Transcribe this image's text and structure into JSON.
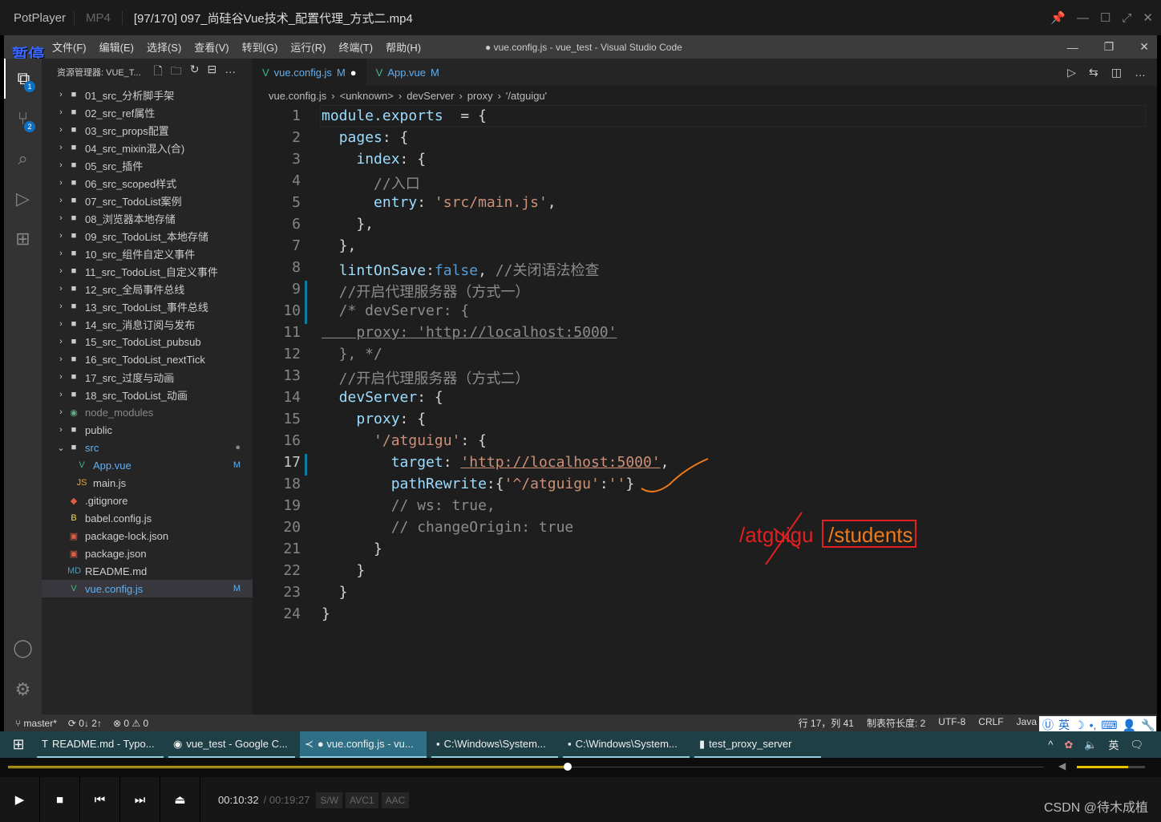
{
  "player": {
    "brand": "PotPlayer",
    "format": "MP4",
    "file": "[97/170] 097_尚硅谷Vue技术_配置代理_方式二.mp4",
    "pause_label": "暂停",
    "elapsed": "00:10:32",
    "total": "/ 00:19:27",
    "tags": [
      "S/W",
      "AVC1",
      "AAC"
    ],
    "progress": 0.54,
    "volume": 0.75,
    "watermark": "CSDN @待木成植"
  },
  "menu": [
    "文件(F)",
    "编辑(E)",
    "选择(S)",
    "查看(V)",
    "转到(G)",
    "运行(R)",
    "终端(T)",
    "帮助(H)"
  ],
  "window_title": "● vue.config.js - vue_test - Visual Studio Code",
  "activity": {
    "explorer_badge": "1",
    "scm_badge": "2"
  },
  "explorer": {
    "title": "资源管理器: VUE_T...",
    "items": [
      {
        "label": "01_src_分析脚手架",
        "type": "folder"
      },
      {
        "label": "02_src_ref属性",
        "type": "folder"
      },
      {
        "label": "03_src_props配置",
        "type": "folder"
      },
      {
        "label": "04_src_mixin混入(合)",
        "type": "folder"
      },
      {
        "label": "05_src_插件",
        "type": "folder"
      },
      {
        "label": "06_src_scoped样式",
        "type": "folder"
      },
      {
        "label": "07_src_TodoList案例",
        "type": "folder"
      },
      {
        "label": "08_浏览器本地存储",
        "type": "folder"
      },
      {
        "label": "09_src_TodoList_本地存储",
        "type": "folder"
      },
      {
        "label": "10_src_组件自定义事件",
        "type": "folder"
      },
      {
        "label": "11_src_TodoList_自定义事件",
        "type": "folder"
      },
      {
        "label": "12_src_全局事件总线",
        "type": "folder"
      },
      {
        "label": "13_src_TodoList_事件总线",
        "type": "folder"
      },
      {
        "label": "14_src_消息订阅与发布",
        "type": "folder"
      },
      {
        "label": "15_src_TodoList_pubsub",
        "type": "folder"
      },
      {
        "label": "16_src_TodoList_nextTick",
        "type": "folder"
      },
      {
        "label": "17_src_过度与动画",
        "type": "folder"
      },
      {
        "label": "18_src_TodoList_动画",
        "type": "folder"
      },
      {
        "label": "node_modules",
        "type": "folder-dim"
      },
      {
        "label": "public",
        "type": "folder"
      },
      {
        "label": "src",
        "type": "folder-open",
        "status": "●"
      },
      {
        "label": "App.vue",
        "type": "vue",
        "indent": 2,
        "status": "M"
      },
      {
        "label": "main.js",
        "type": "js",
        "indent": 2
      },
      {
        "label": ".gitignore",
        "type": "git"
      },
      {
        "label": "babel.config.js",
        "type": "babel"
      },
      {
        "label": "package-lock.json",
        "type": "json"
      },
      {
        "label": "package.json",
        "type": "json"
      },
      {
        "label": "README.md",
        "type": "md"
      },
      {
        "label": "vue.config.js",
        "type": "vue",
        "status": "M",
        "selected": true
      }
    ]
  },
  "tabs": [
    {
      "label": "vue.config.js",
      "status": "M",
      "dirty": "●",
      "active": true
    },
    {
      "label": "App.vue",
      "status": "M"
    }
  ],
  "breadcrumb": [
    "vue.config.js",
    "<unknown>",
    "devServer",
    "proxy",
    "'/atguigu'"
  ],
  "code": {
    "current_line": 17,
    "lines": [
      [
        [
          "k",
          "module.exports"
        ],
        [
          "",
          "  = {"
        ]
      ],
      [
        [
          "",
          "  "
        ],
        [
          "k",
          "pages"
        ],
        [
          "",
          ": {"
        ]
      ],
      [
        [
          "",
          "    "
        ],
        [
          "k",
          "index"
        ],
        [
          "",
          ": {"
        ]
      ],
      [
        [
          "c",
          "      //入口"
        ]
      ],
      [
        [
          "",
          "      "
        ],
        [
          "k",
          "entry"
        ],
        [
          "",
          ": "
        ],
        [
          "s",
          "'src/main.js'"
        ],
        [
          "",
          ","
        ]
      ],
      [
        [
          "",
          "    },"
        ]
      ],
      [
        [
          "",
          "  },"
        ]
      ],
      [
        [
          "",
          "  "
        ],
        [
          "k",
          "lintOnSave"
        ],
        [
          "",
          ":"
        ],
        [
          "b",
          "false"
        ],
        [
          "",
          ", "
        ],
        [
          "c",
          "//关闭语法检查"
        ]
      ],
      [
        [
          "c",
          "  //开启代理服务器（方式一）"
        ]
      ],
      [
        [
          "c",
          "  /* devServer: {"
        ]
      ],
      [
        [
          "c",
          "    proxy: 'http://localhost:5000'"
        ]
      ],
      [
        [
          "c",
          "  }, */"
        ]
      ],
      [
        [
          "c",
          "  //开启代理服务器（方式二）"
        ]
      ],
      [
        [
          "",
          "  "
        ],
        [
          "k",
          "devServer"
        ],
        [
          "",
          ": {"
        ]
      ],
      [
        [
          "",
          "    "
        ],
        [
          "k",
          "proxy"
        ],
        [
          "",
          ": {"
        ]
      ],
      [
        [
          "",
          "      "
        ],
        [
          "s",
          "'/atguigu'"
        ],
        [
          "",
          ": {"
        ]
      ],
      [
        [
          "",
          "        "
        ],
        [
          "k",
          "target"
        ],
        [
          "",
          ": "
        ],
        [
          "s",
          "'http://localhost:5000'"
        ],
        [
          "",
          ","
        ]
      ],
      [
        [
          "",
          "        "
        ],
        [
          "k",
          "pathRewrite"
        ],
        [
          "",
          ":{"
        ],
        [
          "s",
          "'^/atguigu'"
        ],
        [
          "",
          ":"
        ],
        [
          "s",
          "''"
        ],
        [
          "",
          "}"
        ]
      ],
      [
        [
          "c",
          "        // ws: true,"
        ]
      ],
      [
        [
          "c",
          "        // changeOrigin: true"
        ]
      ],
      [
        [
          "",
          "      }"
        ]
      ],
      [
        [
          "",
          "    }"
        ]
      ],
      [
        [
          "",
          "  }"
        ]
      ],
      [
        [
          "",
          "}"
        ]
      ]
    ]
  },
  "annotation": {
    "text_struck": "/atguigu",
    "text_boxed": "/students",
    "color": "#e02020",
    "stroke_color": "#f07a1a"
  },
  "status": {
    "branch": "master*",
    "sync": "0↓ 2↑",
    "problems": "⊗ 0 ⚠ 0",
    "position": "行 17，列 41",
    "tab_size": "制表符长度: 2",
    "encoding": "UTF-8",
    "eol": "CRLF",
    "language": "Java"
  },
  "ime": {
    "lang": "英"
  },
  "taskbar": [
    {
      "label": "README.md - Typo...",
      "icon": "typora"
    },
    {
      "label": "vue_test - Google C...",
      "icon": "chrome"
    },
    {
      "label": "● vue.config.js - vu...",
      "icon": "vscode",
      "active": true
    },
    {
      "label": "C:\\Windows\\System...",
      "icon": "cmd"
    },
    {
      "label": "C:\\Windows\\System...",
      "icon": "cmd"
    },
    {
      "label": "test_proxy_server",
      "icon": "folder"
    }
  ],
  "tray": {
    "lang": "英"
  }
}
